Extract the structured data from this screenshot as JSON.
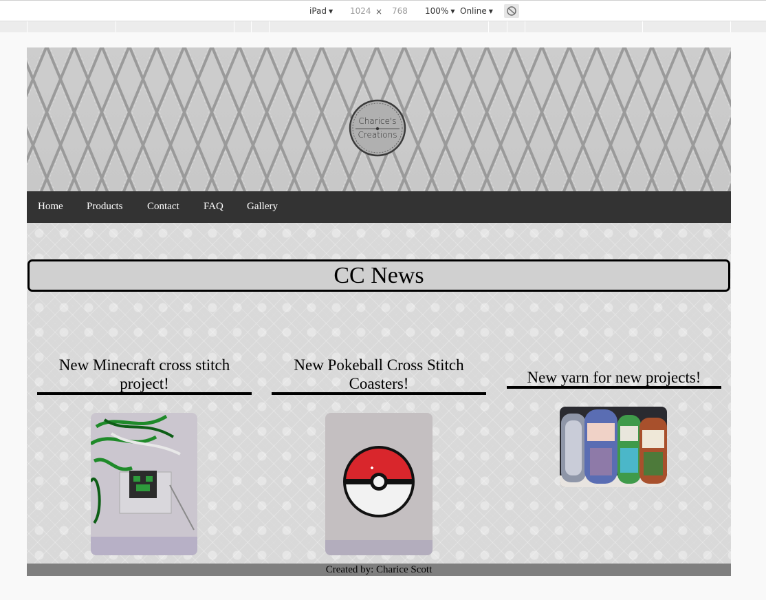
{
  "devtools": {
    "device": "iPad",
    "width": "1024",
    "times": "×",
    "height": "768",
    "zoom": "100%",
    "network": "Online",
    "rotate_icon": "rotate-icon"
  },
  "site": {
    "logo": {
      "line1": "Charice's",
      "line2": "Creations"
    },
    "nav": [
      "Home",
      "Products",
      "Contact",
      "FAQ",
      "Gallery"
    ],
    "headline": "CC News",
    "news": [
      {
        "title": "New Minecraft cross stitch project!"
      },
      {
        "title": "New Pokeball Cross Stitch Coasters!"
      },
      {
        "title": "New yarn for new projects!"
      }
    ],
    "footer": "Created by: Charice Scott"
  },
  "colors": {
    "navbar": "#333333",
    "footer": "#7f7f7f",
    "headline_box": "#d0d0d0",
    "banner": "#c8c8c8"
  }
}
